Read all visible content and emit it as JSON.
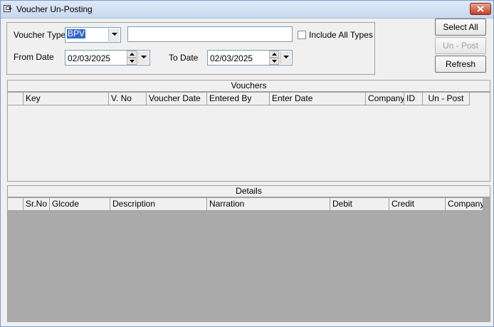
{
  "window": {
    "title": "Voucher Un-Posting"
  },
  "filters": {
    "voucher_type_label": "Voucher Type",
    "voucher_type_value": "BPV",
    "voucher_desc_value": "",
    "include_all_types_label": "Include All Types",
    "include_all_types_checked": false,
    "from_date_label": "From Date",
    "from_date_value": "02/03/2025",
    "to_date_label": "To Date",
    "to_date_value": "02/03/2025"
  },
  "buttons": {
    "select_all": "Select All",
    "un_post": "Un - Post",
    "refresh": "Refresh"
  },
  "vouchers": {
    "title": "Vouchers",
    "columns": [
      "Key",
      "V. No",
      "Voucher Date",
      "Entered By",
      "Enter Date",
      "Company",
      "ID",
      "Un - Post"
    ],
    "rows": []
  },
  "details": {
    "title": "Details",
    "columns": [
      "Sr.No",
      "Glcode",
      "Description",
      "Narration",
      "Debit",
      "Credit",
      "Company"
    ],
    "rows": []
  }
}
